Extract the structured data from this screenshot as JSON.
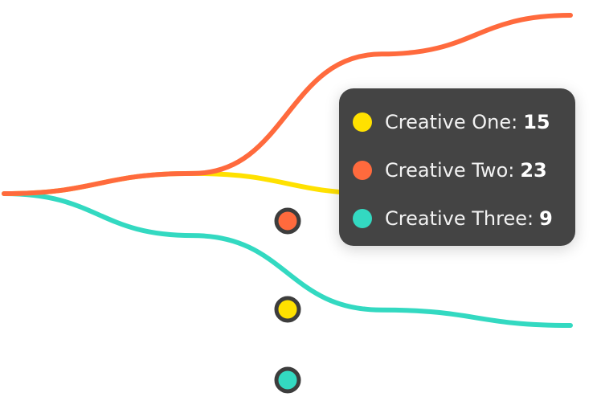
{
  "chart_data": {
    "type": "line",
    "series": [
      {
        "name": "Creative One",
        "color": "#ffe100",
        "values": [
          0,
          2.6,
          0,
          1.4
        ]
      },
      {
        "name": "Creative Two",
        "color": "#ff6a3d",
        "values": [
          0,
          2.6,
          18,
          23
        ]
      },
      {
        "name": "Creative Three",
        "color": "#33d9c1",
        "values": [
          0,
          -5.4,
          -15,
          -17
        ]
      }
    ],
    "highlight_values": [
      15,
      23,
      9
    ],
    "grid": false,
    "legend": "none"
  },
  "tooltip": {
    "items": [
      {
        "label": "Creative One",
        "value": "15",
        "color": "#ffe100"
      },
      {
        "label": "Creative Two",
        "value": "23",
        "color": "#ff6a3d"
      },
      {
        "label": "Creative Three",
        "value": "9",
        "color": "#33d9c1"
      }
    ]
  },
  "colors": {
    "tooltip_bg": "#444444",
    "marker_ring": "#3d3d3d"
  }
}
